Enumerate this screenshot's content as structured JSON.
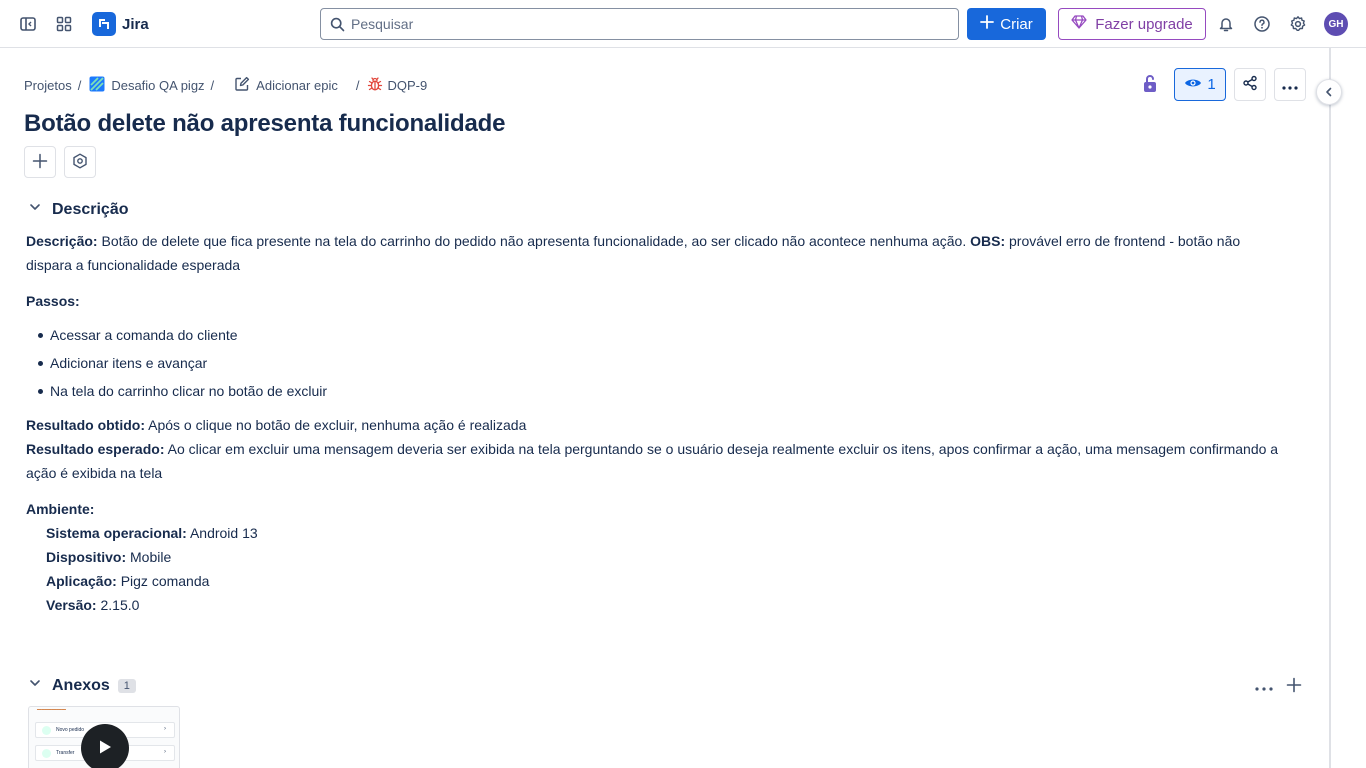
{
  "topnav": {
    "app_name": "Jira",
    "search_placeholder": "Pesquisar",
    "create_label": "Criar",
    "upgrade_label": "Fazer upgrade",
    "avatar_initials": "GH",
    "icons": [
      "sidebar-toggle-icon",
      "app-switcher-icon",
      "jira-logo-icon",
      "search-icon",
      "plus-icon",
      "diamond-icon",
      "bell-icon",
      "help-icon",
      "gear-icon"
    ]
  },
  "breadcrumb": {
    "projects": "Projetos",
    "project": "Desafio QA pigz",
    "add_epic": "Adicionar epic",
    "issue_key": "DQP-9",
    "separator": "/"
  },
  "actions": {
    "watch_count": "1"
  },
  "issue": {
    "title": "Botão delete não apresenta funcionalidade"
  },
  "description": {
    "heading": "Descrição",
    "desc_label": "Descrição:",
    "desc_text": " Botão de delete que fica presente na tela do carrinho do pedido não apresenta funcionalidade, ao ser clicado não acontece nenhuma ação. ",
    "obs_label": "OBS:",
    "obs_text": " provável erro de frontend - botão não dispara a funcionalidade esperada",
    "steps_label": "Passos:",
    "steps": [
      "Acessar a comanda do cliente",
      "Adicionar itens e avançar",
      "Na tela do carrinho clicar no botão de excluir"
    ],
    "obtained_label": "Resultado obtido:",
    "obtained_text": " Após o clique no botão de excluir, nenhuma ação é realizada",
    "expected_label": "Resultado esperado:",
    "expected_text": " Ao clicar em excluir uma mensagem deveria ser exibida na tela perguntando se o usuário deseja realmente excluir os itens, apos confirmar a ação, uma mensagem confirmando a ação é exibida na tela",
    "env_label": "Ambiente:",
    "env": [
      {
        "label": "Sistema operacional:",
        "value": " Android 13"
      },
      {
        "label": "Dispositivo:",
        "value": " Mobile"
      },
      {
        "label": "Aplicação:",
        "value": " Pigz comanda"
      },
      {
        "label": "Versão:",
        "value": " 2.15.0"
      }
    ]
  },
  "attachments": {
    "heading": "Anexos",
    "count": "1",
    "thumbnail": {
      "rows": [
        "Novo pedido",
        "Transfer"
      ]
    }
  },
  "colors": {
    "primary": "#1868db",
    "upgrade": "#803fa5",
    "text": "#172b4d",
    "bug": "#e2483d",
    "avatar": "#5e4db2"
  }
}
